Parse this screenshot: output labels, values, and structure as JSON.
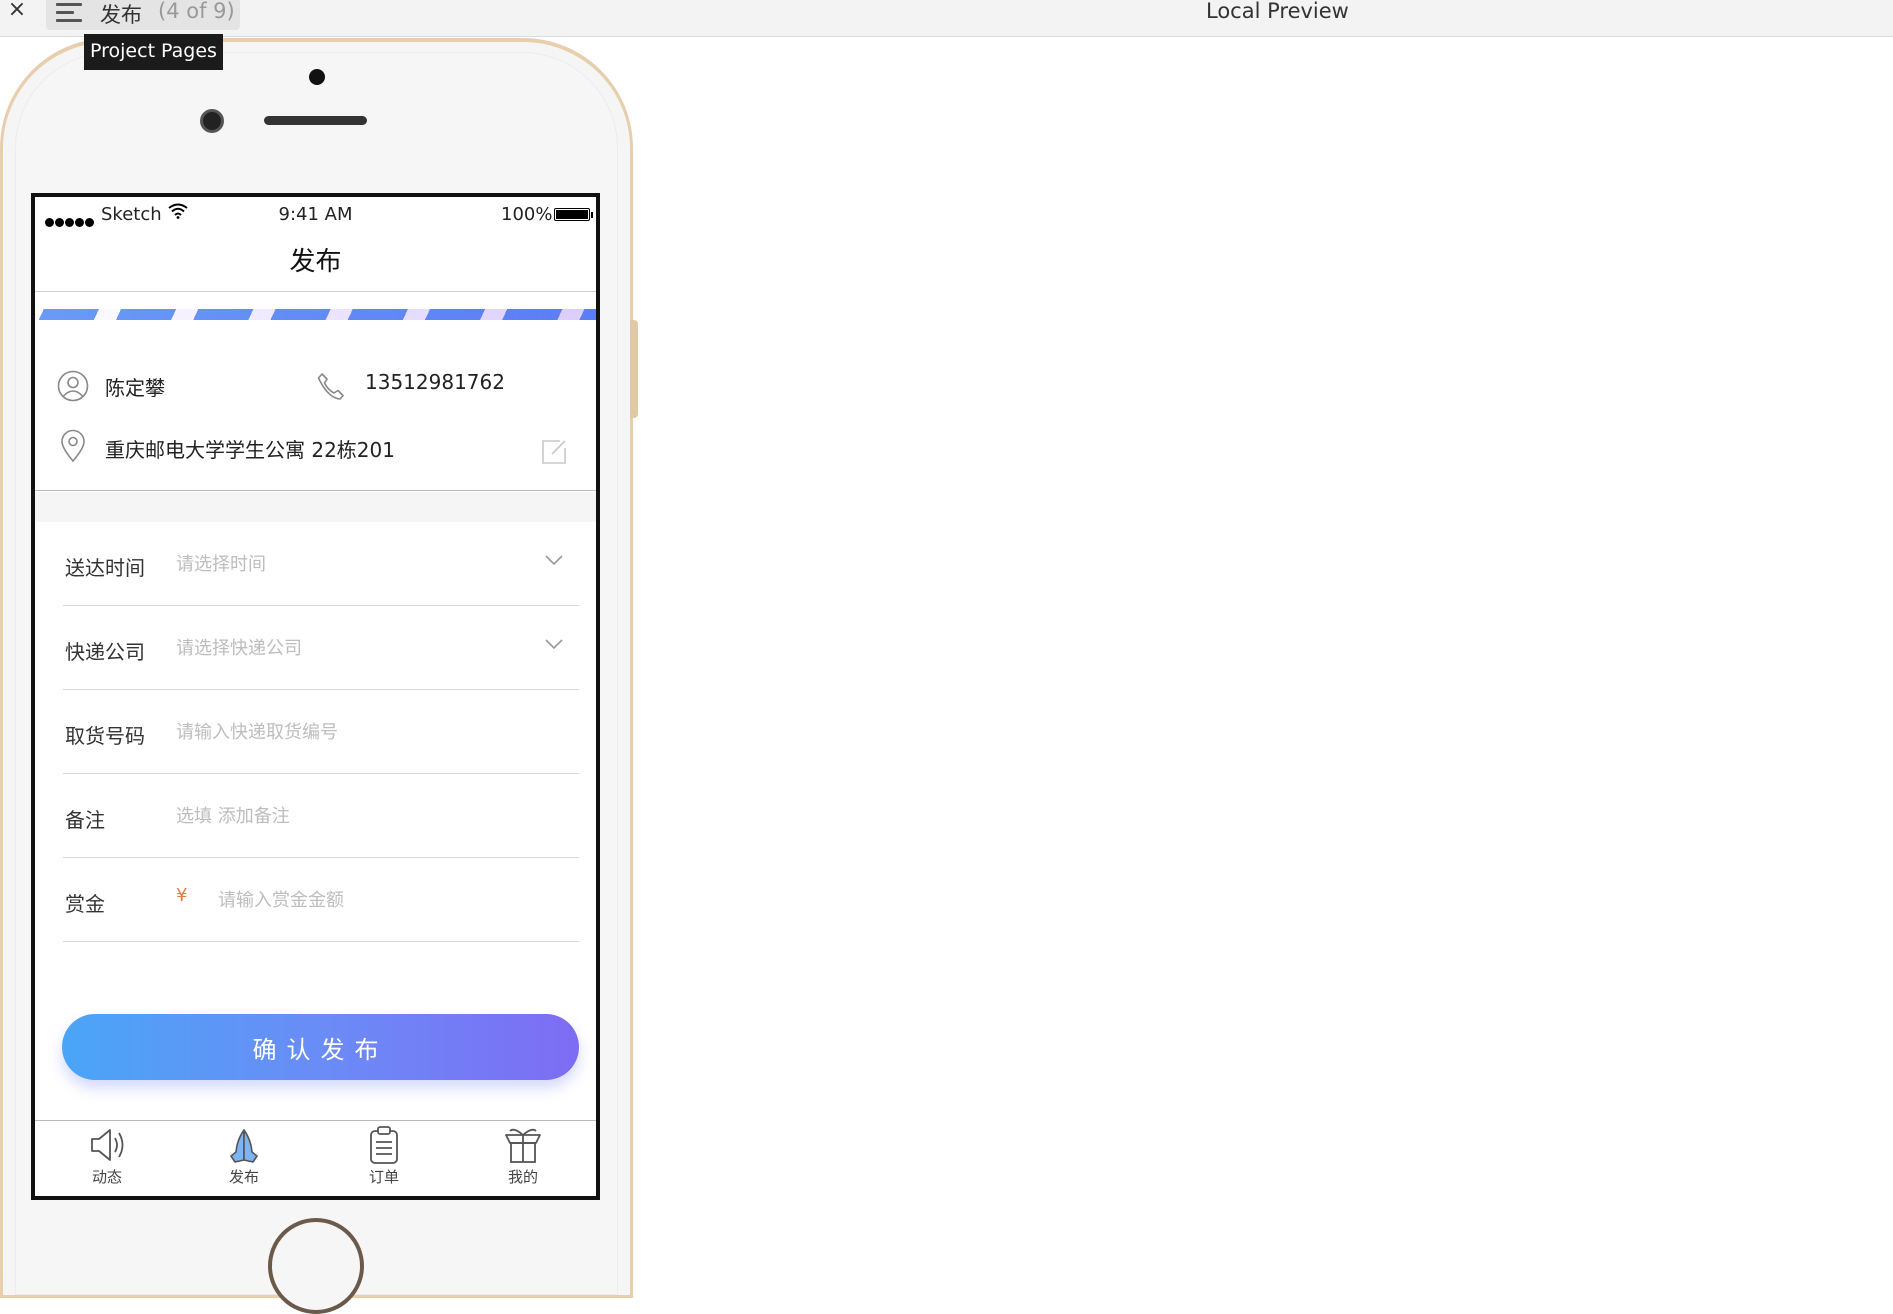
{
  "window": {
    "close_glyph": "×",
    "page_name": "发布",
    "page_count": "(4 of 9)",
    "title": "Local Preview",
    "tooltip": "Project Pages"
  },
  "status_bar": {
    "carrier": "Sketch",
    "time": "9:41 AM",
    "battery": "100%"
  },
  "nav": {
    "title": "发布"
  },
  "contact": {
    "name": "陈定攀",
    "phone": "13512981762",
    "address": "重庆邮电大学学生公寓 22栋201"
  },
  "form": {
    "delivery_time": {
      "label": "送达时间",
      "placeholder": "请选择时间"
    },
    "courier": {
      "label": "快递公司",
      "placeholder": "请选择快递公司"
    },
    "pickup_code": {
      "label": "取货号码",
      "placeholder": "请输入快递取货编号"
    },
    "note": {
      "label": "备注",
      "placeholder": "选填 添加备注"
    },
    "reward": {
      "label": "赏金",
      "currency": "¥",
      "placeholder": "请输入赏金金额"
    }
  },
  "submit_label": "确认发布",
  "tabs": [
    {
      "label": "动态"
    },
    {
      "label": "发布"
    },
    {
      "label": "订单"
    },
    {
      "label": "我的"
    }
  ],
  "colors": {
    "accent_start": "#4aa5f7",
    "accent_end": "#7e6cf4",
    "currency": "#e77a48",
    "phone_frame": "#e7cfae"
  }
}
